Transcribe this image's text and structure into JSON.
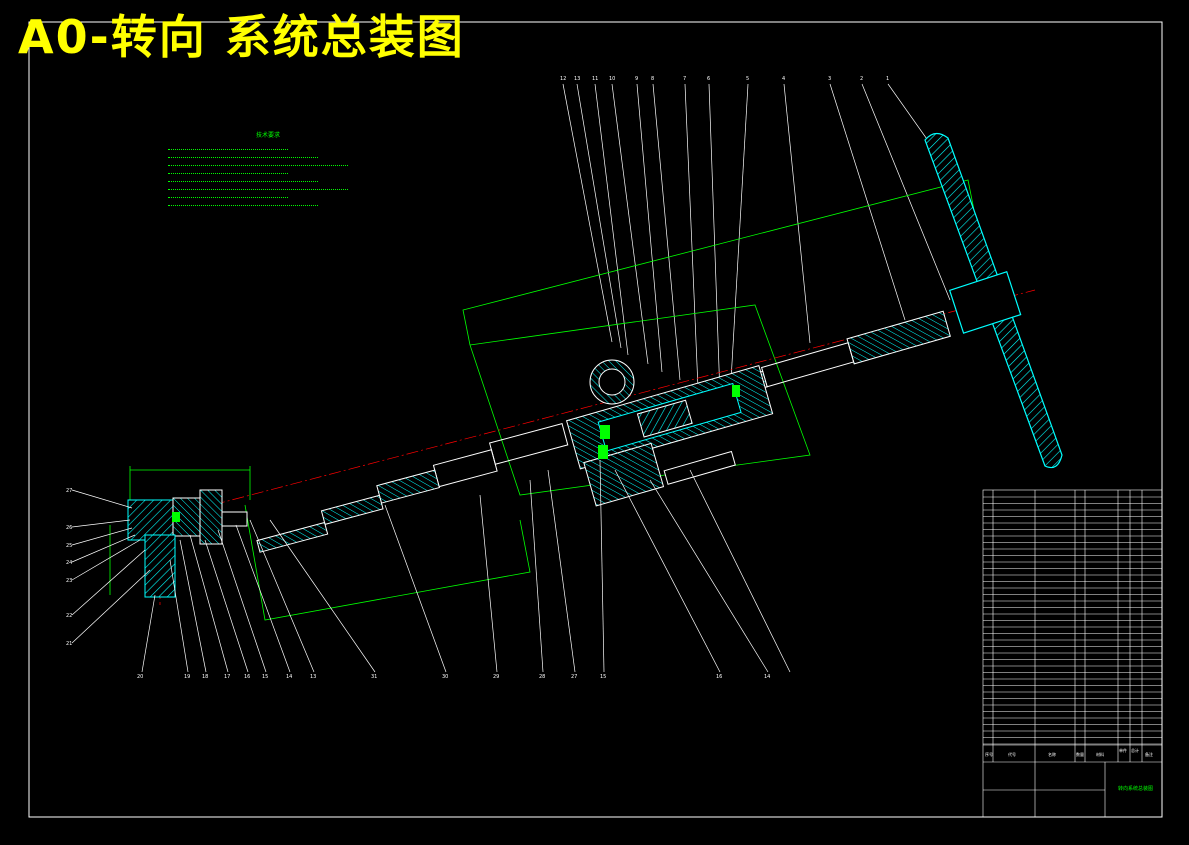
{
  "drawing": {
    "title": "A0-转向 系统总装图",
    "notes": {
      "heading": "技术要求",
      "items": [
        "",
        "",
        "",
        "",
        "",
        "",
        "",
        ""
      ]
    },
    "balloons_top": [
      "12",
      "13",
      "11",
      "10",
      "9",
      "8",
      "7",
      "6",
      "5",
      "4",
      "3",
      "2",
      "1"
    ],
    "balloons_left": [
      "27",
      "26",
      "25",
      "24",
      "23",
      "22",
      "21"
    ],
    "balloons_bottom": [
      "20",
      "19",
      "18",
      "17",
      "16",
      "15",
      "14",
      "13",
      "31",
      "30",
      "29",
      "28",
      "27",
      "15",
      "16",
      "14"
    ],
    "colors": {
      "background": "#000000",
      "title": "#ffff00",
      "outline": "#ffffff",
      "part": "#00ffff",
      "dimension": "#00ff00",
      "centerline": "#ff0000"
    },
    "title_block": {
      "header": [
        "序号",
        "代号",
        "名称",
        "数量",
        "材料",
        "单件",
        "总计",
        "备注"
      ],
      "drawing_name": "转向系统总装图"
    }
  }
}
